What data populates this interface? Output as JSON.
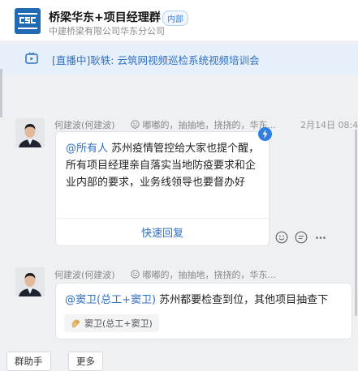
{
  "header": {
    "title": "桥梁华东+项目经理群",
    "tag": "内部",
    "subtitle": "中建桥梁有限公司华东分公司"
  },
  "live": {
    "text": "[直播中]耿轶: 云筑网视频巡检系统视频培训会"
  },
  "messages": [
    {
      "sender": "何建波(何建波)",
      "status": "嘟嘟的，抽抽地，挠挠的，华东...",
      "time": "2月14日 08:4",
      "mention": "@所有人",
      "body": " 苏州疫情管控给大家也提个醒，所有项目经理亲自落实当地防疫要求和企业内部的要求，业务线领导也要督办好",
      "quick_reply": "快速回复"
    },
    {
      "sender": "何建波(何建波)",
      "status": "嘟嘟的，抽抽地，挠挠的，华东...",
      "mention": "@窦卫(总工+窦卫)",
      "body": " 苏州都要检查到位，其他项目抽查下",
      "reaction_user": "窦卫(总工+窦卫)"
    }
  ],
  "footer": {
    "assistant_label": "群助手",
    "more_label": "更多"
  }
}
